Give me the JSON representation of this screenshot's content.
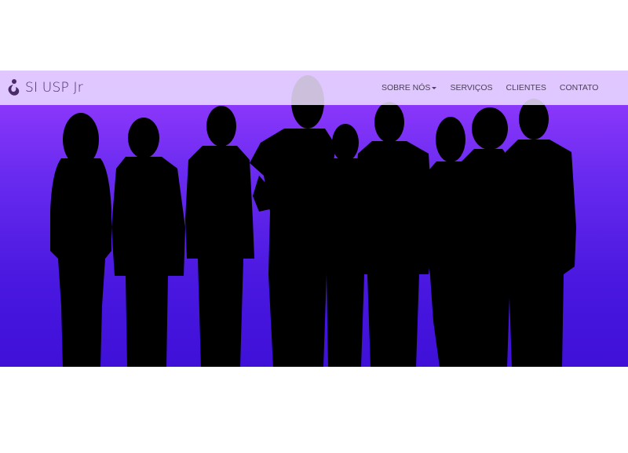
{
  "brand": {
    "name": "SI USP Jr",
    "logo_icon": "si-logo-icon",
    "color": "#4a2a68"
  },
  "nav": {
    "items": [
      {
        "label": "SOBRE NÓS",
        "has_dropdown": true
      },
      {
        "label": "SERVIÇOS",
        "has_dropdown": false
      },
      {
        "label": "CLIENTES",
        "has_dropdown": false
      },
      {
        "label": "CONTATO",
        "has_dropdown": false
      }
    ]
  },
  "hero": {
    "image": "team-silhouettes",
    "gradient_top": "#9a3dff",
    "gradient_bottom": "#3f10d8"
  }
}
